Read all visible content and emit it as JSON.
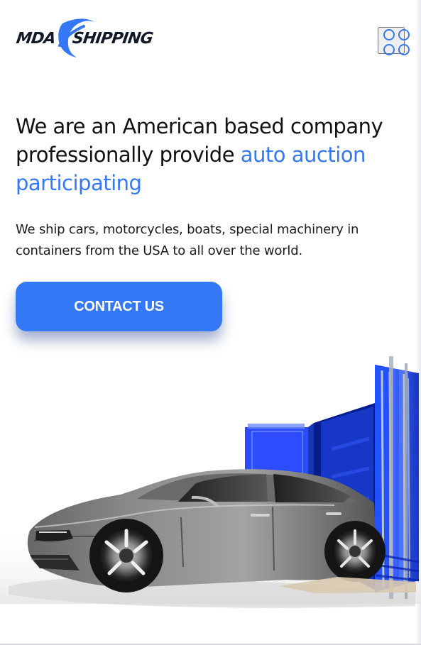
{
  "brand": {
    "left_word": "MDA",
    "right_word": "SHIPPING",
    "accent_color": "#3478f6",
    "text_color": "#111827"
  },
  "header": {
    "menu_icon": "grid-menu-icon"
  },
  "hero": {
    "title_prefix": "We are an American based company professionally provide ",
    "title_highlight": "auto auction participating",
    "description": "We ship cars, motorcycles, boats, special machinery in containers from the USA to all over the world.",
    "cta_label": "CONTACT US",
    "cta_color": "#3478f6",
    "image_icon": "car-container-illustration"
  }
}
